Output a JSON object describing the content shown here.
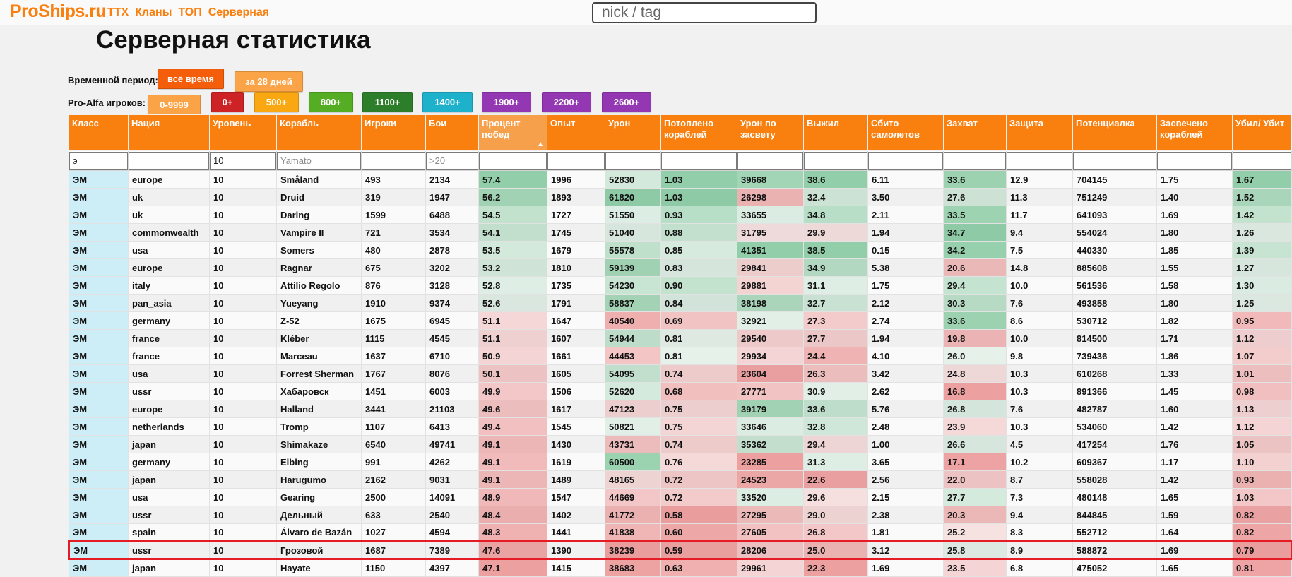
{
  "site": {
    "logo": "ProShips.ru",
    "nav": [
      "ТТХ",
      "Кланы",
      "ТОП",
      "Серверная"
    ],
    "search_placeholder": "nick / tag"
  },
  "page_title": "Серверная статистика",
  "period": {
    "label": "Временной период:",
    "buttons": [
      {
        "label": "всё время",
        "color": "#f45d0a",
        "active": true
      },
      {
        "label": "за 28 дней",
        "color": "#fba447",
        "active": false
      }
    ]
  },
  "proalfa": {
    "label": "Pro-Alfa игроков:",
    "buttons": [
      {
        "label": "0-9999",
        "color": "#fba447"
      },
      {
        "label": "0+",
        "color": "#cd2226"
      },
      {
        "label": "500+",
        "color": "#f9a812"
      },
      {
        "label": "800+",
        "color": "#54ad22"
      },
      {
        "label": "1100+",
        "color": "#2d7e2a"
      },
      {
        "label": "1400+",
        "color": "#1eb1cb"
      },
      {
        "label": "1900+",
        "color": "#9338b2"
      },
      {
        "label": "2200+",
        "color": "#9338b2"
      },
      {
        "label": "2600+",
        "color": "#9338b2"
      }
    ]
  },
  "table": {
    "columns": [
      {
        "label": "Класс",
        "filter": "э",
        "placeholder": ""
      },
      {
        "label": "Нация",
        "filter": "",
        "placeholder": ""
      },
      {
        "label": "Уровень",
        "filter": "10",
        "placeholder": ""
      },
      {
        "label": "Корабль",
        "filter": "",
        "placeholder": "Yamato"
      },
      {
        "label": "Игроки",
        "filter": "",
        "placeholder": ""
      },
      {
        "label": "Бои",
        "filter": "",
        "placeholder": ">20"
      },
      {
        "label": "Процент побед",
        "filter": "",
        "placeholder": "",
        "sorted": true
      },
      {
        "label": "Опыт",
        "filter": "",
        "placeholder": ""
      },
      {
        "label": "Урон",
        "filter": "",
        "placeholder": ""
      },
      {
        "label": "Потоплено кораблей",
        "filter": "",
        "placeholder": ""
      },
      {
        "label": "Урон по засвету",
        "filter": "",
        "placeholder": ""
      },
      {
        "label": "Выжил",
        "filter": "",
        "placeholder": ""
      },
      {
        "label": "Сбито самолетов",
        "filter": "",
        "placeholder": ""
      },
      {
        "label": "Захват",
        "filter": "",
        "placeholder": ""
      },
      {
        "label": "Защита",
        "filter": "",
        "placeholder": ""
      },
      {
        "label": "Потенциалка",
        "filter": "",
        "placeholder": ""
      },
      {
        "label": "Засвечено кораблей",
        "filter": "",
        "placeholder": ""
      },
      {
        "label": "Убил/ Убит",
        "filter": "",
        "placeholder": ""
      }
    ],
    "sort_indicator": "▲",
    "highlighted_ship": "Грозовой",
    "rows": [
      [
        "ЭМ",
        "europe",
        "10",
        "Småland",
        "493",
        "2134",
        "57.4",
        "1996",
        "52830",
        "1.03",
        "39668",
        "38.6",
        "6.11",
        "33.6",
        "12.9",
        "704145",
        "1.75",
        "1.67"
      ],
      [
        "ЭМ",
        "uk",
        "10",
        "Druid",
        "319",
        "1947",
        "56.2",
        "1893",
        "61820",
        "1.03",
        "26298",
        "32.4",
        "3.50",
        "27.6",
        "11.3",
        "751249",
        "1.40",
        "1.52"
      ],
      [
        "ЭМ",
        "uk",
        "10",
        "Daring",
        "1599",
        "6488",
        "54.5",
        "1727",
        "51550",
        "0.93",
        "33655",
        "34.8",
        "2.11",
        "33.5",
        "11.7",
        "641093",
        "1.69",
        "1.42"
      ],
      [
        "ЭМ",
        "commonwealth",
        "10",
        "Vampire II",
        "721",
        "3534",
        "54.1",
        "1745",
        "51040",
        "0.88",
        "31795",
        "29.9",
        "1.94",
        "34.7",
        "9.4",
        "554024",
        "1.80",
        "1.26"
      ],
      [
        "ЭМ",
        "usa",
        "10",
        "Somers",
        "480",
        "2878",
        "53.5",
        "1679",
        "55578",
        "0.85",
        "41351",
        "38.5",
        "0.15",
        "34.2",
        "7.5",
        "440330",
        "1.85",
        "1.39"
      ],
      [
        "ЭМ",
        "europe",
        "10",
        "Ragnar",
        "675",
        "3202",
        "53.2",
        "1810",
        "59139",
        "0.83",
        "29841",
        "34.9",
        "5.38",
        "20.6",
        "14.8",
        "885608",
        "1.55",
        "1.27"
      ],
      [
        "ЭМ",
        "italy",
        "10",
        "Attilio Regolo",
        "876",
        "3128",
        "52.8",
        "1735",
        "54230",
        "0.90",
        "29881",
        "31.1",
        "1.75",
        "29.4",
        "10.0",
        "561536",
        "1.58",
        "1.30"
      ],
      [
        "ЭМ",
        "pan_asia",
        "10",
        "Yueyang",
        "1910",
        "9374",
        "52.6",
        "1791",
        "58837",
        "0.84",
        "38198",
        "32.7",
        "2.12",
        "30.3",
        "7.6",
        "493858",
        "1.80",
        "1.25"
      ],
      [
        "ЭМ",
        "germany",
        "10",
        "Z-52",
        "1675",
        "6945",
        "51.1",
        "1647",
        "40540",
        "0.69",
        "32921",
        "27.3",
        "2.74",
        "33.6",
        "8.6",
        "530712",
        "1.82",
        "0.95"
      ],
      [
        "ЭМ",
        "france",
        "10",
        "Kléber",
        "1115",
        "4545",
        "51.1",
        "1607",
        "54944",
        "0.81",
        "29540",
        "27.7",
        "1.94",
        "19.8",
        "10.0",
        "814500",
        "1.71",
        "1.12"
      ],
      [
        "ЭМ",
        "france",
        "10",
        "Marceau",
        "1637",
        "6710",
        "50.9",
        "1661",
        "44453",
        "0.81",
        "29934",
        "24.4",
        "4.10",
        "26.0",
        "9.8",
        "739436",
        "1.86",
        "1.07"
      ],
      [
        "ЭМ",
        "usa",
        "10",
        "Forrest Sherman",
        "1767",
        "8076",
        "50.1",
        "1605",
        "54095",
        "0.74",
        "23604",
        "26.3",
        "3.42",
        "24.8",
        "10.3",
        "610268",
        "1.33",
        "1.01"
      ],
      [
        "ЭМ",
        "ussr",
        "10",
        "Хабаровск",
        "1451",
        "6003",
        "49.9",
        "1506",
        "52620",
        "0.68",
        "27771",
        "30.9",
        "2.62",
        "16.8",
        "10.3",
        "891366",
        "1.45",
        "0.98"
      ],
      [
        "ЭМ",
        "europe",
        "10",
        "Halland",
        "3441",
        "21103",
        "49.6",
        "1617",
        "47123",
        "0.75",
        "39179",
        "33.6",
        "5.76",
        "26.8",
        "7.6",
        "482787",
        "1.60",
        "1.13"
      ],
      [
        "ЭМ",
        "netherlands",
        "10",
        "Tromp",
        "1107",
        "6413",
        "49.4",
        "1545",
        "50821",
        "0.75",
        "33646",
        "32.8",
        "2.48",
        "23.9",
        "10.3",
        "534060",
        "1.42",
        "1.12"
      ],
      [
        "ЭМ",
        "japan",
        "10",
        "Shimakaze",
        "6540",
        "49741",
        "49.1",
        "1430",
        "43731",
        "0.74",
        "35362",
        "29.4",
        "1.00",
        "26.6",
        "4.5",
        "417254",
        "1.76",
        "1.05"
      ],
      [
        "ЭМ",
        "germany",
        "10",
        "Elbing",
        "991",
        "4262",
        "49.1",
        "1619",
        "60500",
        "0.76",
        "23285",
        "31.3",
        "3.65",
        "17.1",
        "10.2",
        "609367",
        "1.17",
        "1.10"
      ],
      [
        "ЭМ",
        "japan",
        "10",
        "Harugumo",
        "2162",
        "9031",
        "49.1",
        "1489",
        "48165",
        "0.72",
        "24523",
        "22.6",
        "2.56",
        "22.0",
        "8.7",
        "558028",
        "1.42",
        "0.93"
      ],
      [
        "ЭМ",
        "usa",
        "10",
        "Gearing",
        "2500",
        "14091",
        "48.9",
        "1547",
        "44669",
        "0.72",
        "33520",
        "29.6",
        "2.15",
        "27.7",
        "7.3",
        "480148",
        "1.65",
        "1.03"
      ],
      [
        "ЭМ",
        "ussr",
        "10",
        "Дельный",
        "633",
        "2540",
        "48.4",
        "1402",
        "41772",
        "0.58",
        "27295",
        "29.0",
        "2.38",
        "20.3",
        "9.4",
        "844845",
        "1.59",
        "0.82"
      ],
      [
        "ЭМ",
        "spain",
        "10",
        "Álvaro de Bazán",
        "1027",
        "4594",
        "48.3",
        "1441",
        "41838",
        "0.60",
        "27605",
        "26.8",
        "1.81",
        "25.2",
        "8.3",
        "552712",
        "1.64",
        "0.82"
      ],
      [
        "ЭМ",
        "ussr",
        "10",
        "Грозовой",
        "1687",
        "7389",
        "47.6",
        "1390",
        "38239",
        "0.59",
        "28206",
        "25.0",
        "3.12",
        "25.8",
        "8.9",
        "588872",
        "1.69",
        "0.79"
      ],
      [
        "ЭМ",
        "japan",
        "10",
        "Hayate",
        "1150",
        "4397",
        "47.1",
        "1415",
        "38683",
        "0.63",
        "29961",
        "22.3",
        "1.69",
        "23.5",
        "6.8",
        "475052",
        "1.65",
        "0.81"
      ]
    ]
  }
}
